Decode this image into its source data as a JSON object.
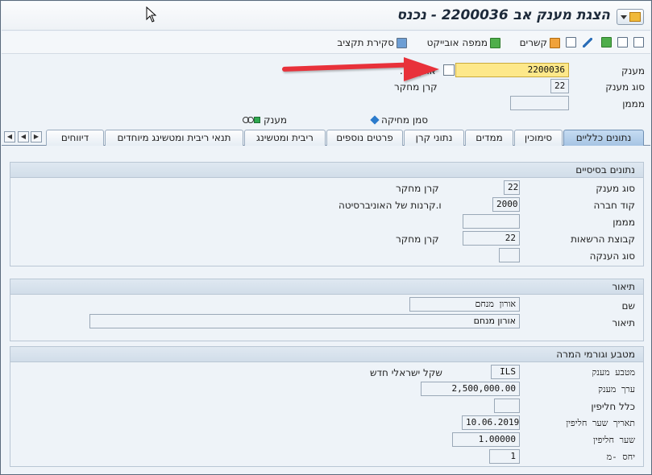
{
  "window": {
    "title": "הצגת מענק אב 2200036 - נכנס"
  },
  "toolbar": {
    "budget_review": "סקירת תקציב",
    "object_map": "ממפה אובייקט",
    "links": "קשרים"
  },
  "header": {
    "grant_label": "מענק",
    "grant_value": "2200036",
    "grant_desc": "אורן מ...",
    "grant_type_label": "סוג מענק",
    "grant_type_value": "22",
    "grant_type_desc": "קרן מחקר",
    "sponsor_label": "מממן",
    "sponsor_value": "",
    "legend_delete_flag": "סמן מחיקה",
    "legend_grant": "מענק"
  },
  "tabs": [
    {
      "label": "נתונים כלליים",
      "active": true
    },
    {
      "label": "סימוכין"
    },
    {
      "label": "ממדים"
    },
    {
      "label": "נתוני קרן"
    },
    {
      "label": "פרטים נוספים"
    },
    {
      "label": "ריבית ומטשינג"
    },
    {
      "label": "תנאי ריבית ומטשינג מיוחדים"
    },
    {
      "label": "דיווחים"
    }
  ],
  "basic": {
    "title": "נתונים בסיסיים",
    "grant_type_label": "סוג מענק",
    "grant_type_value": "22",
    "grant_type_desc": "קרן מחקר",
    "company_code_label": "קוד חברה",
    "company_code_value": "2000",
    "company_code_desc": "ו.קרנות של האוניברסיטה",
    "sponsor_label": "מממן",
    "sponsor_value": "",
    "auth_group_label": "קבוצת הרשאות",
    "auth_group_value": "22",
    "auth_group_desc": "קרן מחקר",
    "award_type_label": "סוג הענקה",
    "award_type_value": ""
  },
  "description": {
    "title": "תיאור",
    "name_label": "שם",
    "name_value": "אורון מנחם",
    "desc_label": "תיאור",
    "desc_value": "אורון מנחם"
  },
  "currency": {
    "title": "מטבע וגורמי המרה",
    "grant_currency_label": "מטבע מענק",
    "grant_currency_value": "ILS",
    "grant_currency_desc": "שקל ישראלי חדש",
    "grant_value_label": "ערך מענק",
    "grant_value_value": "2,500,000.00",
    "exchange_rule_label": "כלל חליפין",
    "exchange_rule_value": "",
    "exchange_date_label": "תאריך שער חליפין",
    "exchange_date_value": "10.06.2019",
    "exchange_rate_label": "שער חליפין",
    "exchange_rate_value": "1.00000",
    "ratio_label": "יחס -מ",
    "ratio_value": "1"
  },
  "colors": {
    "accent_arrow": "#e8313a",
    "active_tab": "#b5cfea",
    "required_field": "#fde88a"
  }
}
